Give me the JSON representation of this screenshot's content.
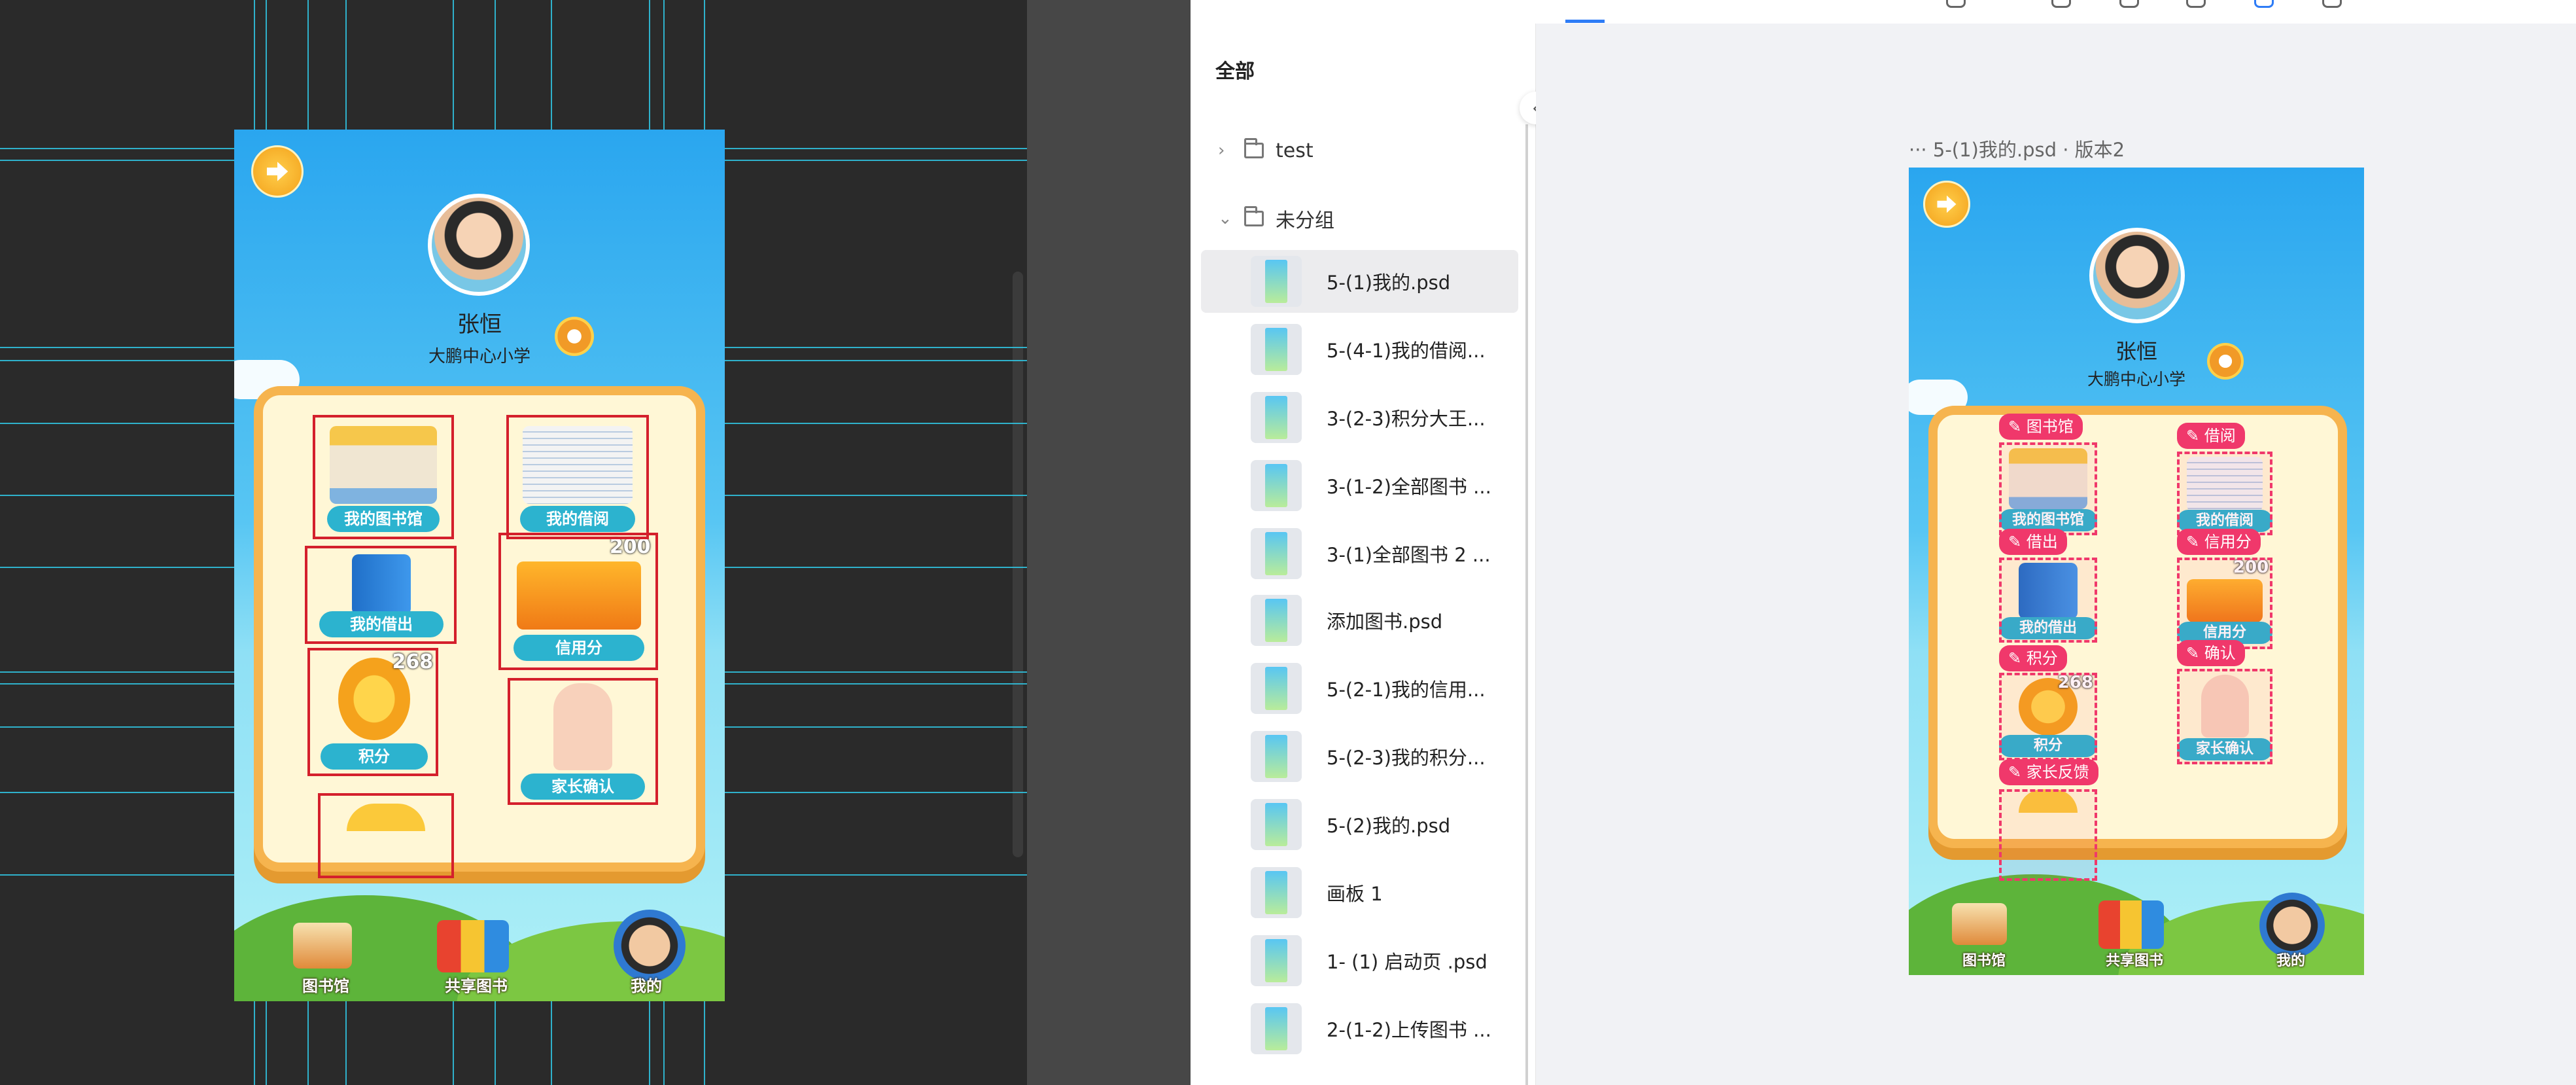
{
  "profile": {
    "name": "张恒",
    "school": "大鹏中心小学"
  },
  "tiles": {
    "library": "我的图书馆",
    "borrow": "我的借阅",
    "lend": "我的借出",
    "credit": "信用分",
    "credit_value": "200",
    "points": "积分",
    "points_value": "268",
    "parent_confirm": "家长确认"
  },
  "tabbar": {
    "library": "图书馆",
    "shared": "共享图书",
    "mine": "我的"
  },
  "panel": {
    "title": "全部",
    "folders": [
      "test",
      "未分组"
    ],
    "files": [
      "5-(1)我的.psd",
      "5-(4-1)我的借阅...",
      "3-(2-3)积分大王...",
      "3-(1-2)全部图书 ...",
      "3-(1)全部图书 2 ...",
      "添加图书.psd",
      "5-(2-1)我的信用...",
      "5-(2-3)我的积分...",
      "5-(2)我的.psd",
      "画板 1",
      "1- (1) 启动页 .psd",
      "2-(1-2)上传图书 ..."
    ]
  },
  "preview": {
    "breadcrumb": "··· 5-(1)我的.psd · 版本2",
    "tags": {
      "library": "图书馆",
      "borrow": "借阅",
      "lend": "借出",
      "credit": "信用分",
      "points": "积分",
      "confirm": "确认",
      "feedback": "家长反馈"
    }
  },
  "colors": {
    "accent": "#f0386b",
    "selection": "#d4202c",
    "guide": "#30c9e8",
    "tab_active": "#2e7cf6"
  }
}
